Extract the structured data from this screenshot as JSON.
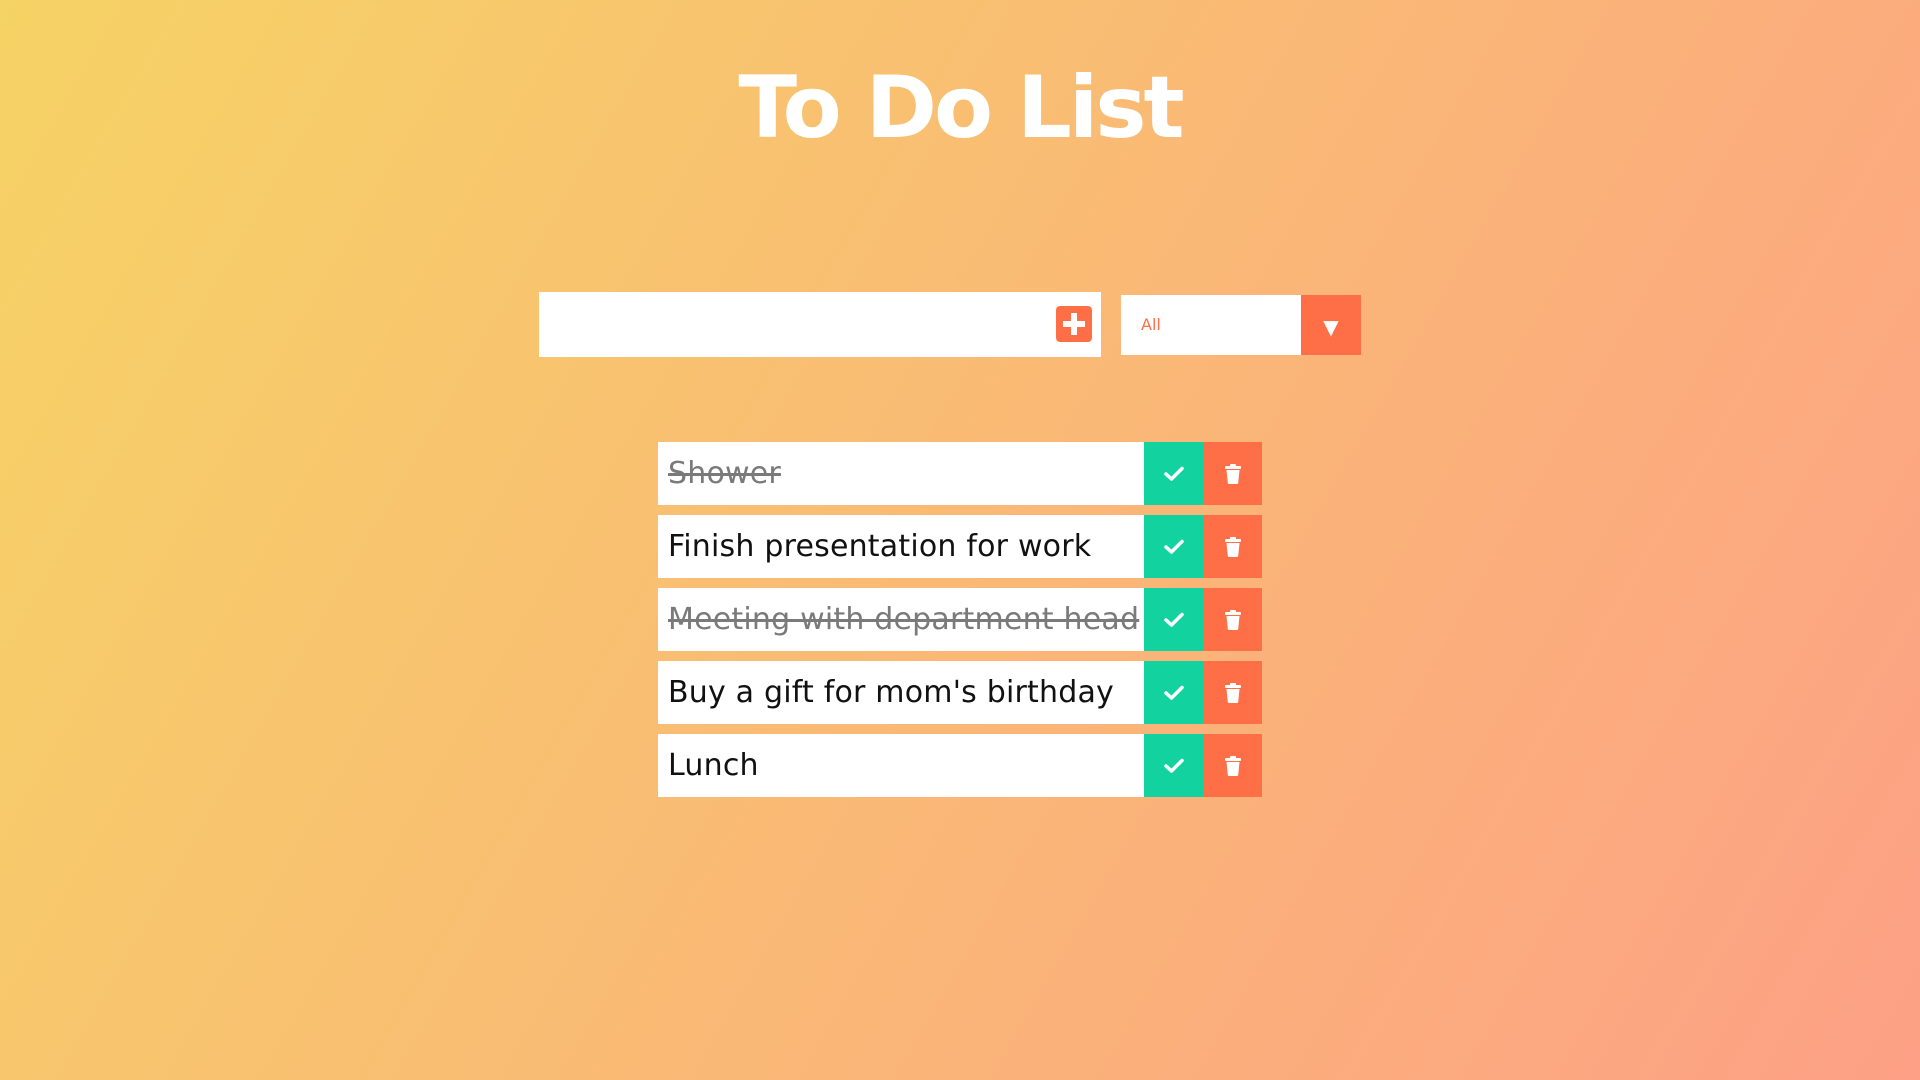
{
  "header": {
    "title": "To Do List"
  },
  "form": {
    "input_value": "",
    "input_placeholder": "",
    "add_icon": "plus-square-icon",
    "filter_selected": "All",
    "filter_arrow": "▼"
  },
  "todos": [
    {
      "text": "Shower",
      "completed": true
    },
    {
      "text": "Finish presentation for work",
      "completed": false
    },
    {
      "text": "Meeting with department head",
      "completed": true
    },
    {
      "text": "Buy a gift for mom's birthday",
      "completed": false
    },
    {
      "text": "Lunch",
      "completed": false
    }
  ],
  "colors": {
    "gradient_start": "#f6d365",
    "gradient_end": "#fda085",
    "accent": "#ff6f47",
    "complete": "#12d3a0"
  }
}
